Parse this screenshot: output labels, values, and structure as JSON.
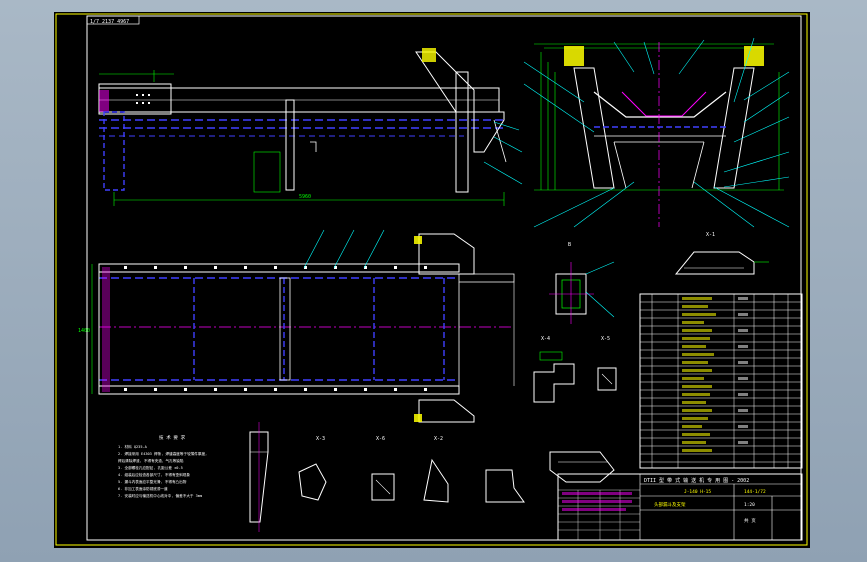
{
  "drawing": {
    "corner_code": "1/7 2137 4967",
    "scheme_title": "DTII 型 带 式 输 送 机 专 用 图 - 2002",
    "drawing_no": "J-140 H-15",
    "assembly_name": "头部漏斗及支架",
    "scale": "1:20",
    "sheet": "共 页",
    "drawing_code": "144-1/72"
  },
  "sections": {
    "x1": "X-1",
    "x2": "X-2",
    "x3": "X-3",
    "x4": "X-4",
    "x5": "X-5",
    "x6": "X-6",
    "b": "B"
  },
  "tech_notes": {
    "title": "技 术 要 求",
    "lines": [
      "1. 材料 Q235-A",
      "2. 焊接采用 E4303 焊条, 焊缝高度等于较薄件厚度,",
      "   焊后清除焊渣, 不得有夹渣、气孔等缺陷",
      "3. 全部螺栓孔应配钻, 孔距公差 ±0.5",
      "4. 组装后应检查各部尺寸, 不得有歪斜现象",
      "5. 漏斗内表面应平整光滑, 不得有凸出物",
      "6. 非加工表面涂防锈底漆一道",
      "7. 安装时应与输送机中心线对中, 偏差不大于 3mm"
    ]
  },
  "dimensions": {
    "overall": "5960",
    "width": "1400"
  },
  "colors": {
    "background": "#000000",
    "frame": "#ffff00",
    "outline": "#ffffff",
    "hidden": "#3a3aff",
    "dim": "#00ff00",
    "center": "#ff00ff",
    "leader": "#00ffff",
    "border": "#ffff00"
  }
}
